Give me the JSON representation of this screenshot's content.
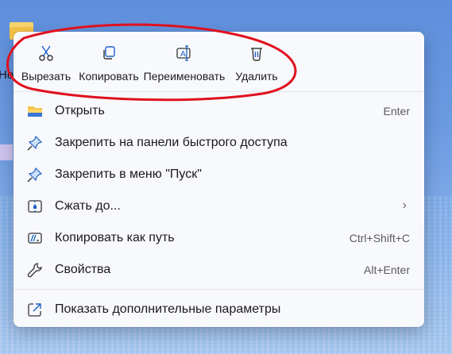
{
  "desktop": {
    "icon_label": "Но"
  },
  "toolbar": {
    "cut": {
      "label": "Вырезать",
      "icon": "scissors-icon"
    },
    "copy": {
      "label": "Копировать",
      "icon": "copy-icon"
    },
    "rename": {
      "label": "Переименовать",
      "icon": "rename-icon"
    },
    "delete": {
      "label": "Удалить",
      "icon": "trash-icon"
    }
  },
  "menu": {
    "items": [
      {
        "label": "Открыть",
        "shortcut": "Enter",
        "icon": "folder-icon"
      },
      {
        "label": "Закрепить на панели быстрого доступа",
        "shortcut": "",
        "icon": "pin-icon"
      },
      {
        "label": "Закрепить в меню \"Пуск\"",
        "shortcut": "",
        "icon": "pin-icon"
      },
      {
        "label": "Сжать до...",
        "shortcut": "",
        "icon": "archive-icon",
        "submenu": "›"
      },
      {
        "label": "Копировать как путь",
        "shortcut": "Ctrl+Shift+C",
        "icon": "path-icon"
      },
      {
        "label": "Свойства",
        "shortcut": "Alt+Enter",
        "icon": "wrench-icon"
      }
    ],
    "more": {
      "label": "Показать дополнительные параметры",
      "icon": "share-icon"
    }
  },
  "colors": {
    "accent": "#1e5fc1",
    "annotation": "#e0101e",
    "folder": "#f4c34a"
  }
}
